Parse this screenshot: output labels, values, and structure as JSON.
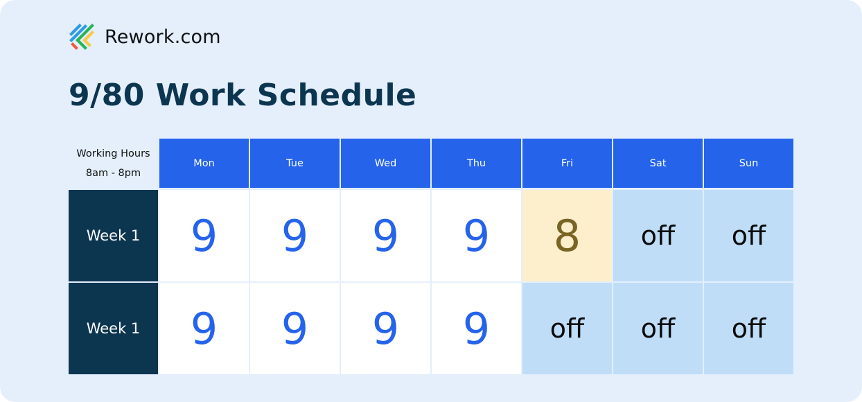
{
  "brand": {
    "logo_icon": "rework-logo-icon",
    "name": "Rework.com"
  },
  "title": "9/80 Work Schedule",
  "table": {
    "corner": {
      "line1": "Working Hours",
      "line2": "8am - 8pm"
    },
    "days": [
      "Mon",
      "Tue",
      "Wed",
      "Thu",
      "Fri",
      "Sat",
      "Sun"
    ],
    "rows": [
      {
        "label": "Week 1",
        "values": [
          "9",
          "9",
          "9",
          "9",
          "8",
          "off",
          "off"
        ],
        "types": [
          "work",
          "work",
          "work",
          "work",
          "short",
          "off",
          "off"
        ]
      },
      {
        "label": "Week 1",
        "values": [
          "9",
          "9",
          "9",
          "9",
          "off",
          "off",
          "off"
        ],
        "types": [
          "work",
          "work",
          "work",
          "work",
          "off",
          "off",
          "off"
        ]
      }
    ]
  },
  "colors": {
    "background": "#E4EFFB",
    "header_blue": "#2563EB",
    "navy": "#0C3550",
    "work_text": "#2563EB",
    "short_day_bg": "#FDEFCC",
    "short_day_text": "#7A6423",
    "off_bg": "#C0DDF8"
  }
}
